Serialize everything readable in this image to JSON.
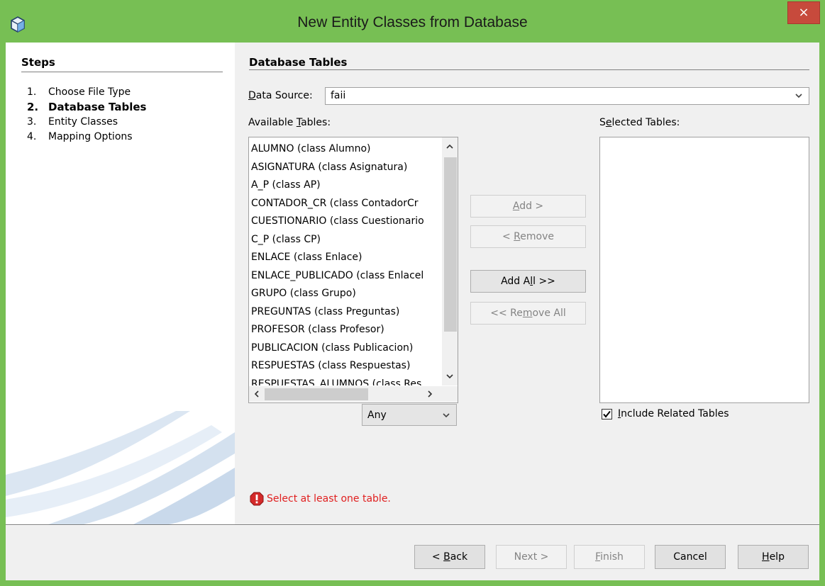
{
  "window": {
    "title": "New Entity Classes from Database",
    "close_label": "×"
  },
  "steps": {
    "heading": "Steps",
    "items": [
      {
        "num": "1.",
        "label": "Choose File Type"
      },
      {
        "num": "2.",
        "label": "Database Tables"
      },
      {
        "num": "3.",
        "label": "Entity Classes"
      },
      {
        "num": "4.",
        "label": "Mapping Options"
      }
    ]
  },
  "section": {
    "heading": "Database Tables"
  },
  "data_source": {
    "label_pre": "D",
    "label_rest": "ata Source:",
    "value": "faii"
  },
  "available": {
    "label_pre": "Available ",
    "label_u": "T",
    "label_rest": "ables:",
    "items": [
      "ALUMNO (class Alumno)",
      "ASIGNATURA (class Asignatura)",
      "A_P (class AP)",
      "CONTADOR_CR (class ContadorCr",
      "CUESTIONARIO (class Cuestionario",
      "C_P (class CP)",
      "ENLACE (class Enlace)",
      "ENLACE_PUBLICADO (class Enlacel",
      "GRUPO (class Grupo)",
      "PREGUNTAS (class Preguntas)",
      "PROFESOR (class Profesor)",
      "PUBLICACION (class Publicacion)",
      "RESPUESTAS (class Respuestas)",
      "RESPUESTAS_ALUMNOS (class Res"
    ],
    "filter_value": "Any"
  },
  "buttons": {
    "add_u": "A",
    "add_rest": "dd >",
    "remove_pre": "< ",
    "remove_u": "R",
    "remove_rest": "emove",
    "add_all_pre": "Add A",
    "add_all_u": "l",
    "add_all_rest": "l >>",
    "remove_all_pre": "<< Re",
    "remove_all_u": "m",
    "remove_all_rest": "ove All"
  },
  "selected": {
    "label_pre": "S",
    "label_u": "e",
    "label_rest": "lected Tables:"
  },
  "include_related": {
    "checked": true,
    "label_u": "I",
    "label_rest": "nclude Related Tables"
  },
  "error": {
    "message": "Select at least one table."
  },
  "footer": {
    "back_pre": "< ",
    "back_u": "B",
    "back_rest": "ack",
    "next": "Next >",
    "finish_u": "F",
    "finish_rest": "inish",
    "cancel": "Cancel",
    "help_u": "H",
    "help_rest": "elp"
  },
  "colors": {
    "title_bar": "#77bf54",
    "close_button": "#c74a3c",
    "error_text": "#e02020"
  }
}
